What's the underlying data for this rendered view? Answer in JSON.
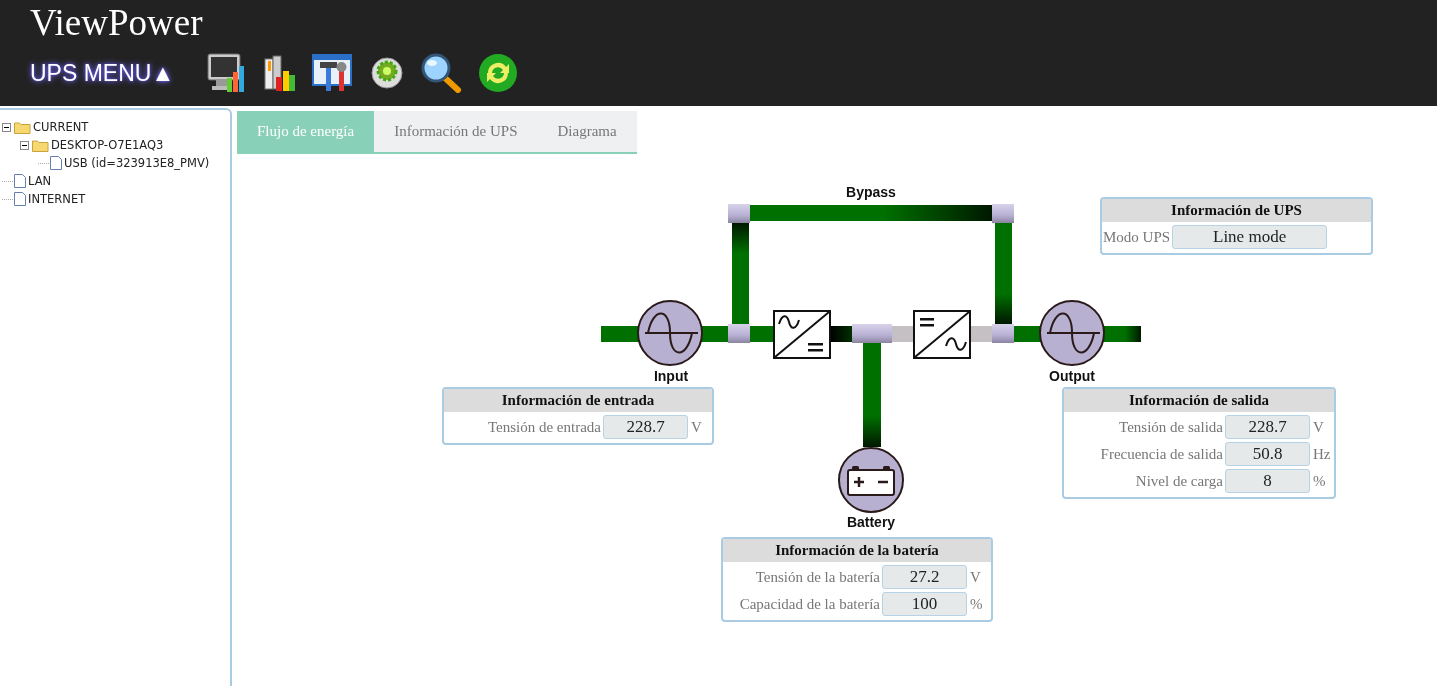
{
  "header": {
    "title": "ViewPower",
    "menu_label": "UPS MENU▲"
  },
  "tree": [
    {
      "label": "CURRENT",
      "kind": "folder",
      "expanded": true,
      "children": [
        {
          "label": "DESKTOP-O7E1AQ3",
          "kind": "folder",
          "expanded": true,
          "children": [
            {
              "label": "USB (id=323913E8_PMV)",
              "kind": "file"
            }
          ]
        }
      ]
    },
    {
      "label": "LAN",
      "kind": "file"
    },
    {
      "label": "INTERNET",
      "kind": "file"
    }
  ],
  "tabs": [
    {
      "label": "Flujo de energía",
      "selected": true
    },
    {
      "label": "Información de UPS",
      "selected": false
    },
    {
      "label": "Diagrama",
      "selected": false
    }
  ],
  "diagram": {
    "bypass_label": "Bypass",
    "input_label": "Input",
    "output_label": "Output",
    "battery_label": "Battery",
    "flow": [
      {
        "active": true
      },
      {
        "active": true
      },
      {
        "active": true
      },
      {
        "active": true
      },
      {
        "active": true
      },
      {
        "active": true
      },
      {
        "active": false
      },
      {
        "active": false
      },
      {
        "active": true
      },
      {
        "active": true
      }
    ]
  },
  "panels": [
    {
      "title": "Información de UPS",
      "kind": "wide",
      "rows": [
        {
          "label": "Modo UPS",
          "value": "Line mode"
        }
      ]
    },
    {
      "title": "Información de entrada",
      "kind": "normal",
      "rows": [
        {
          "label": "Tensión de entrada",
          "value": "228.7",
          "unit": "V"
        }
      ]
    },
    {
      "title": "Información de salida",
      "kind": "normal",
      "rows": [
        {
          "label": "Tensión de salida",
          "value": "228.7",
          "unit": "V"
        },
        {
          "label": "Frecuencia de salida",
          "value": "50.8",
          "unit": "Hz"
        },
        {
          "label": "Nivel de carga",
          "value": "8",
          "unit": "%"
        }
      ]
    },
    {
      "title": "Información de la batería",
      "kind": "normal",
      "rows": [
        {
          "label": "Tensión de la batería",
          "value": "27.2",
          "unit": "V"
        },
        {
          "label": "Capacidad de la batería",
          "value": "100",
          "unit": "%"
        }
      ]
    }
  ]
}
